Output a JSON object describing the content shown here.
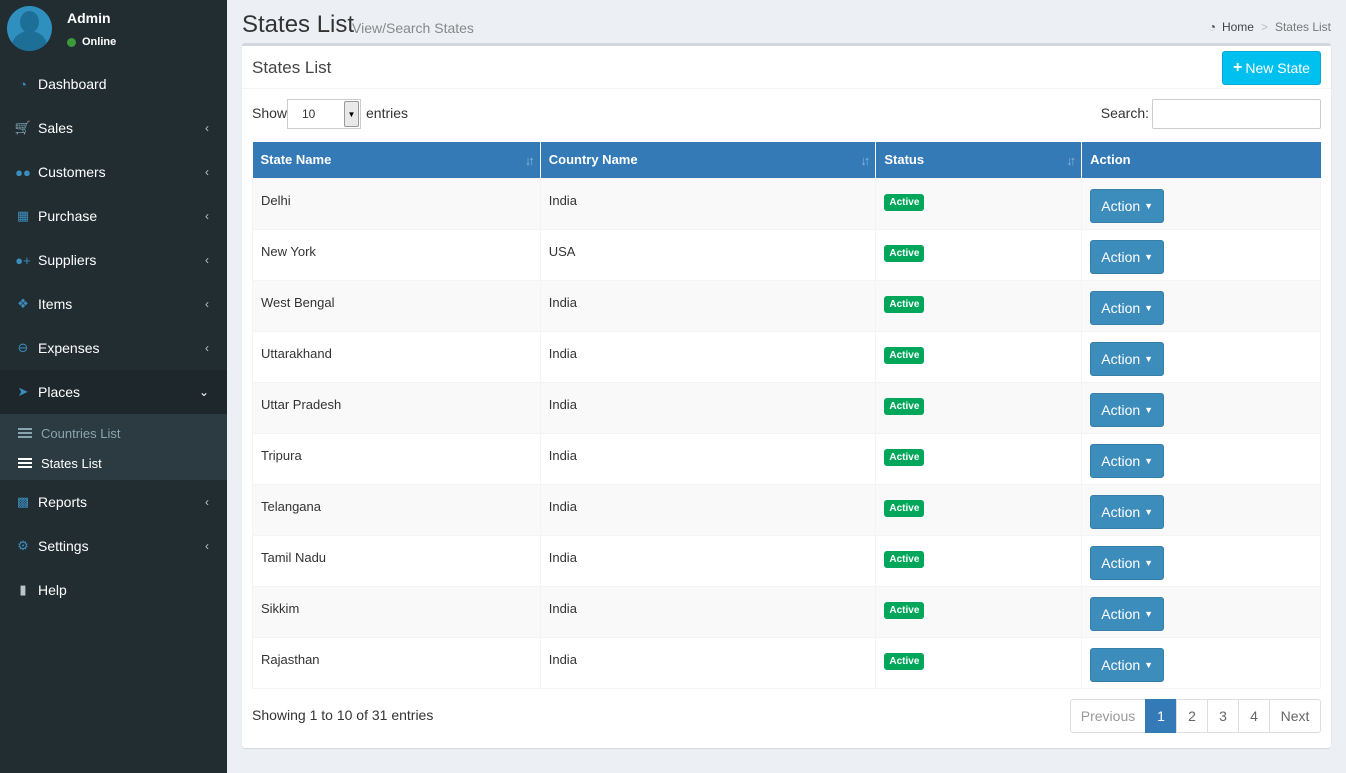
{
  "user": {
    "name": "Admin",
    "status": "Online"
  },
  "sidebar": {
    "items": [
      {
        "label": "Dashboard",
        "icon": "dashboard-icon",
        "chevron": false
      },
      {
        "label": "Sales",
        "icon": "cart-icon",
        "chevron": true
      },
      {
        "label": "Customers",
        "icon": "users-icon",
        "chevron": true
      },
      {
        "label": "Purchase",
        "icon": "grid-icon",
        "chevron": true
      },
      {
        "label": "Suppliers",
        "icon": "user-plus-icon",
        "chevron": true
      },
      {
        "label": "Items",
        "icon": "cubes-icon",
        "chevron": true
      },
      {
        "label": "Expenses",
        "icon": "minus-circle-icon",
        "chevron": true
      }
    ],
    "places": {
      "label": "Places",
      "icon": "paper-plane-icon"
    },
    "places_sub": [
      {
        "label": "Countries List"
      },
      {
        "label": "States List"
      }
    ],
    "items_after": [
      {
        "label": "Reports",
        "icon": "bar-chart-icon"
      },
      {
        "label": "Settings",
        "icon": "cogs-icon"
      },
      {
        "label": "Help",
        "icon": "book-icon"
      }
    ]
  },
  "header": {
    "title": "States List",
    "subtitle": "View/Search States",
    "breadcrumb_home": "Home",
    "breadcrumb_current": "States List"
  },
  "box": {
    "title": "States List",
    "new_button": "New State",
    "show_label": "Show",
    "entries_value": "10",
    "entries_label": "entries",
    "search_label": "Search:",
    "search_value": ""
  },
  "table": {
    "headers": [
      "State Name",
      "Country Name",
      "Status",
      "Action"
    ],
    "rows": [
      {
        "state": "Delhi",
        "country": "India",
        "status": "Active",
        "action": "Action"
      },
      {
        "state": "New York",
        "country": "USA",
        "status": "Active",
        "action": "Action"
      },
      {
        "state": "West Bengal",
        "country": "India",
        "status": "Active",
        "action": "Action"
      },
      {
        "state": "Uttarakhand",
        "country": "India",
        "status": "Active",
        "action": "Action"
      },
      {
        "state": "Uttar Pradesh",
        "country": "India",
        "status": "Active",
        "action": "Action"
      },
      {
        "state": "Tripura",
        "country": "India",
        "status": "Active",
        "action": "Action"
      },
      {
        "state": "Telangana",
        "country": "India",
        "status": "Active",
        "action": "Action"
      },
      {
        "state": "Tamil Nadu",
        "country": "India",
        "status": "Active",
        "action": "Action"
      },
      {
        "state": "Sikkim",
        "country": "India",
        "status": "Active",
        "action": "Action"
      },
      {
        "state": "Rajasthan",
        "country": "India",
        "status": "Active",
        "action": "Action"
      }
    ]
  },
  "footer": {
    "info": "Showing 1 to 10 of 31 entries",
    "previous": "Previous",
    "pages": [
      "1",
      "2",
      "3",
      "4"
    ],
    "next": "Next"
  },
  "colors": {
    "sidebar_bg": "#222d32",
    "accent_blue": "#3c8dbc",
    "table_header": "#337ab7",
    "info_button": "#00c0ef",
    "badge_green": "#00a65a"
  }
}
